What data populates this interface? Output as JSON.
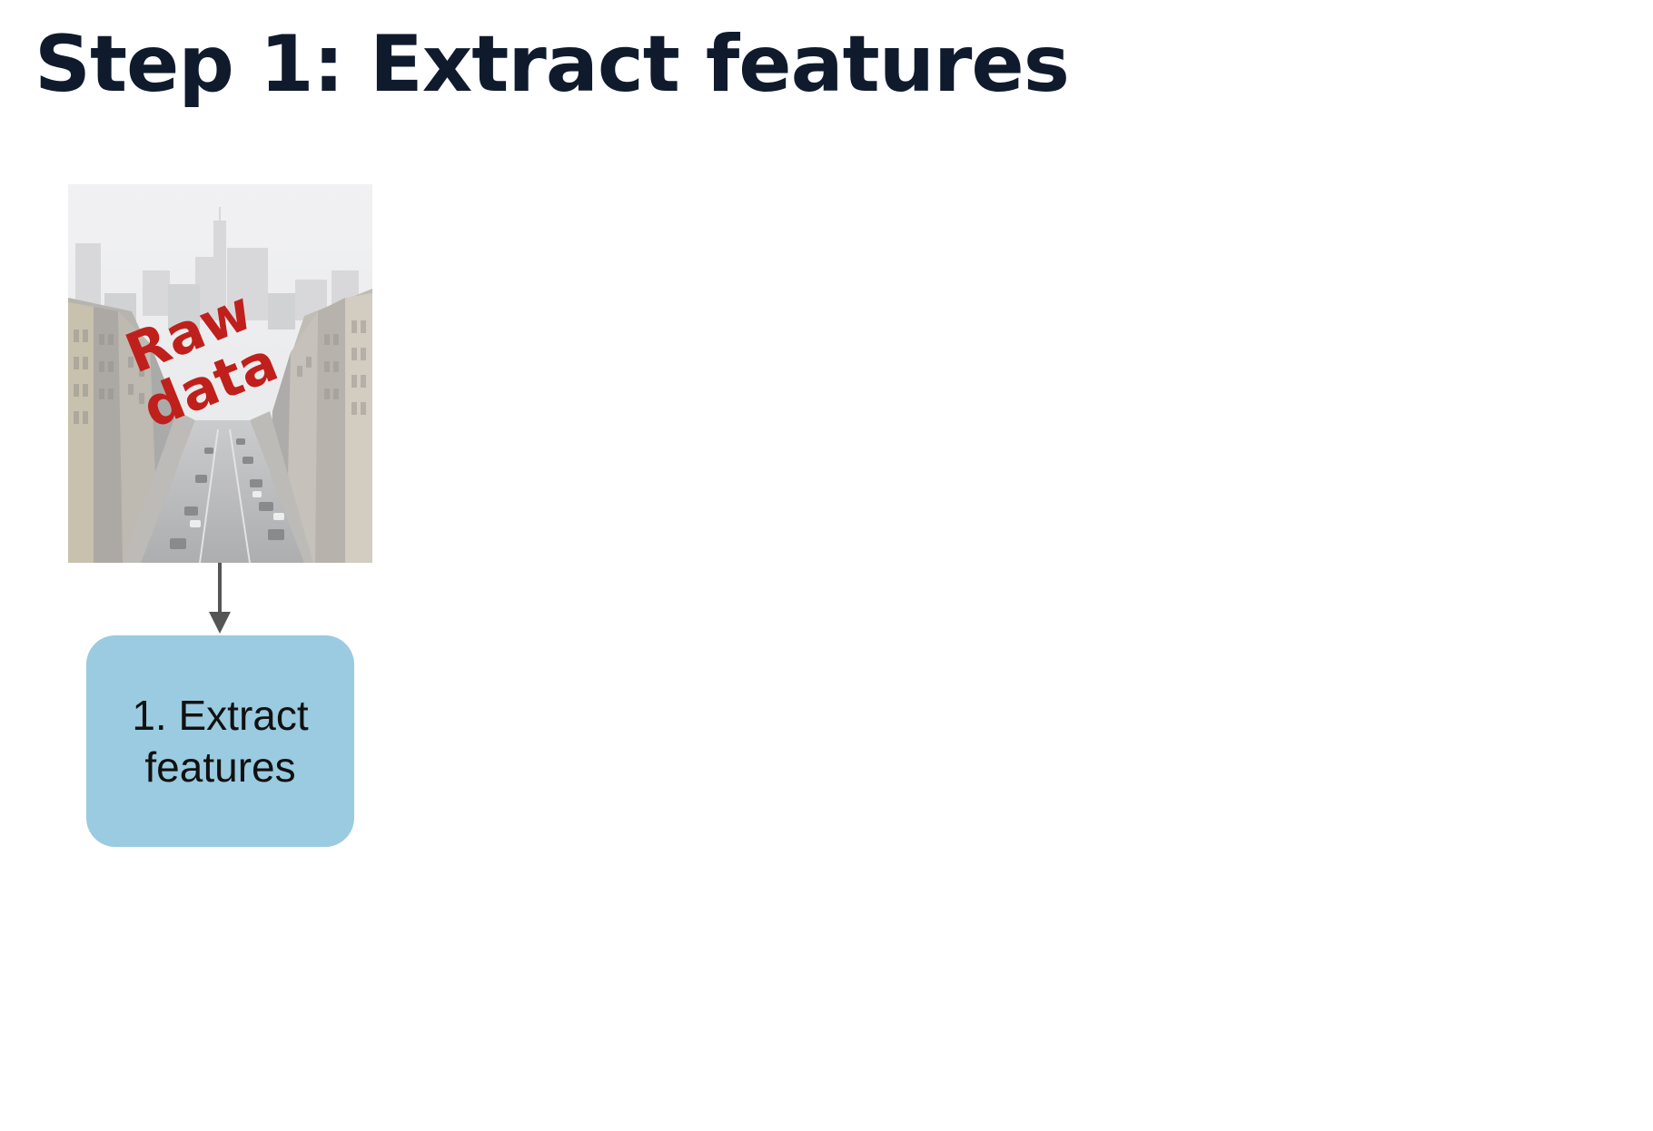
{
  "slide": {
    "title": "Step 1: Extract features"
  },
  "raw_data_image": {
    "label_line1": "Raw",
    "label_line2": "data",
    "label_color": "#c0201c",
    "content": "city-street-photo"
  },
  "arrow": {
    "color": "#555555"
  },
  "step_box": {
    "line1": "1. Extract",
    "line2": "features",
    "fill_color": "#9acbe0"
  },
  "colors": {
    "title": "#0f1b2d",
    "background": "#ffffff"
  }
}
